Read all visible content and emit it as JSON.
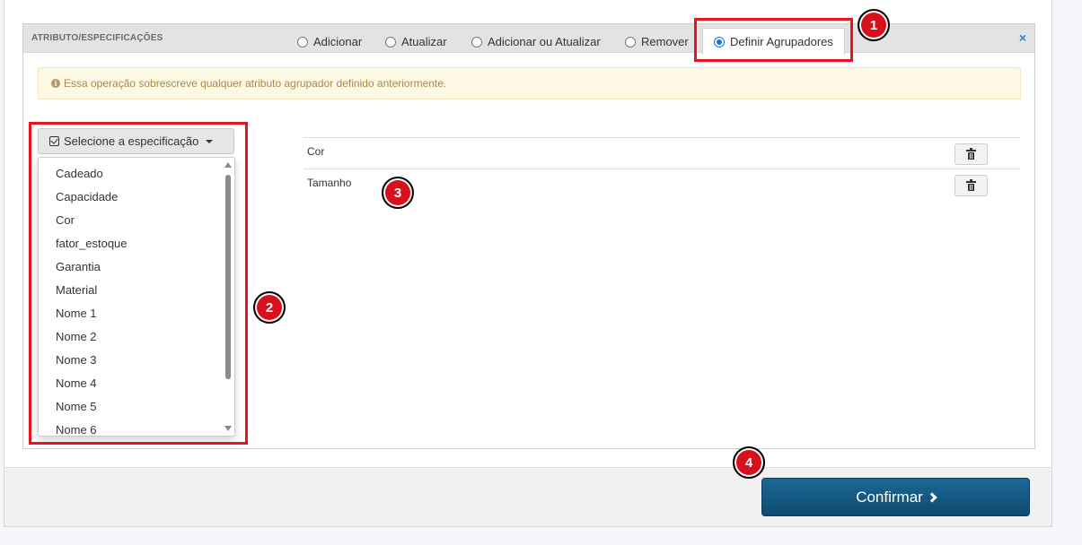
{
  "panel": {
    "title": "ATRIBUTO/ESPECIFICAÇÕES",
    "options": [
      {
        "label": "Adicionar",
        "checked": false
      },
      {
        "label": "Atualizar",
        "checked": false
      },
      {
        "label": "Adicionar ou Atualizar",
        "checked": false
      },
      {
        "label": "Remover",
        "checked": false
      },
      {
        "label": "Definir Agrupadores",
        "checked": true
      }
    ],
    "close_glyph": "×"
  },
  "alert": {
    "icon": "info-icon",
    "text": "Essa operação sobrescreve qualquer atributo agrupador definido anteriormente."
  },
  "dropdown": {
    "button_label": "Selecione a especificação",
    "items": [
      "Cadeado",
      "Capacidade",
      "Cor",
      "fator_estoque",
      "Garantia",
      "Material",
      "Nome 1",
      "Nome 2",
      "Nome 3",
      "Nome 4",
      "Nome 5",
      "Nome 6"
    ]
  },
  "selected": [
    {
      "label": "Cor"
    },
    {
      "label": "Tamanho"
    }
  ],
  "footer": {
    "confirm_label": "Confirmar"
  },
  "badges": [
    "1",
    "2",
    "3",
    "4"
  ],
  "colors": {
    "accent": "#1a73e8",
    "primary_button": "#15597f",
    "highlight": "#e8141f",
    "alert_bg": "#fcf8e3"
  }
}
